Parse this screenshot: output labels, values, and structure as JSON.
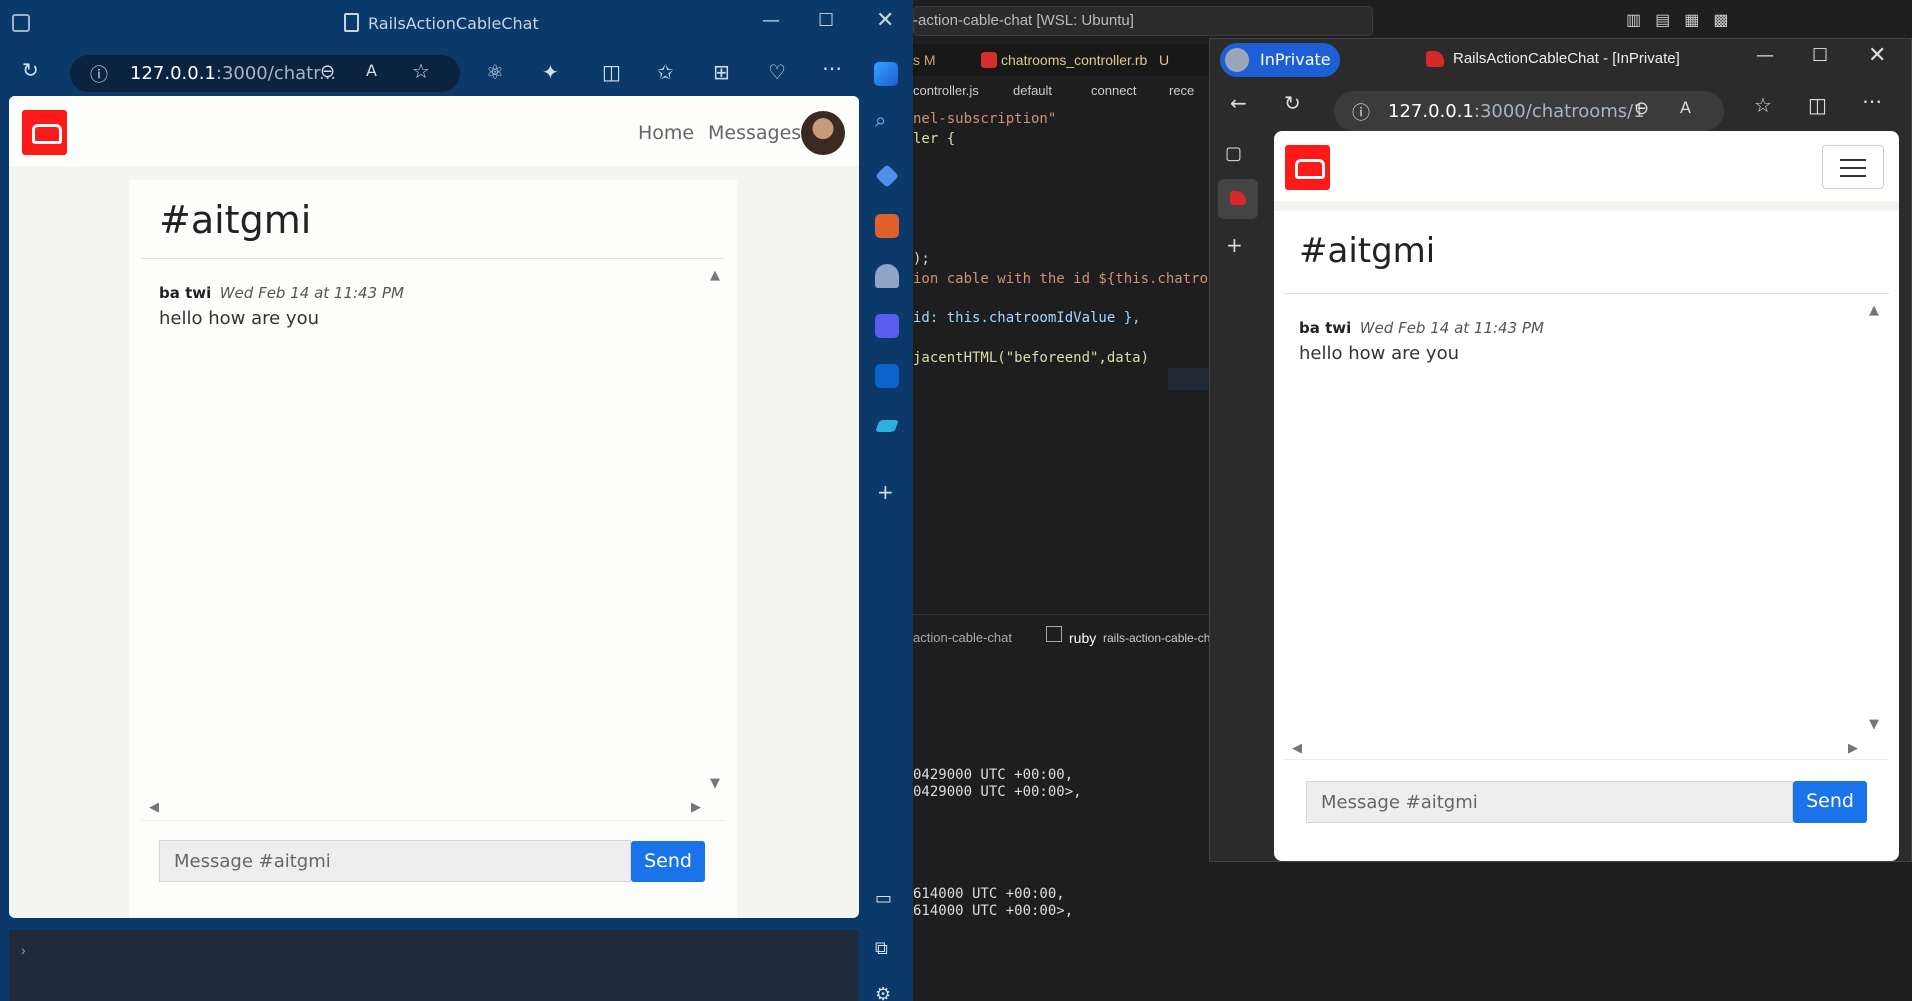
{
  "left_window": {
    "title": "RailsActionCableChat",
    "address_host": "127.0.0.1",
    "address_rest": ":3000/chatr...",
    "nav": {
      "home": "Home",
      "messages": "Messages"
    },
    "room": "#aitgmi",
    "message": {
      "author": "ba twi",
      "time": "Wed Feb 14 at 11:43 PM",
      "body": "hello how are you"
    },
    "input_placeholder": "Message #aitgmi",
    "send_label": "Send"
  },
  "vscode": {
    "title": "-action-cable-chat [WSL: Ubuntu]",
    "tabs": [
      "s M",
      "chatrooms_controller.rb",
      "U"
    ],
    "breadcrumb": [
      "controller.js",
      "default",
      "connect",
      "rece"
    ],
    "code_lines": [
      "nel-subscription\"",
      "ler {",
      "",
      "",
      "",
      "",
      ");",
      "ion cable with the id ${this.chatroom",
      "",
      "id: this.chatroomIdValue },",
      "",
      "jacentHTML(\"beforeend\",data)"
    ],
    "terminal_tabs": [
      "action-cable-chat",
      "ruby",
      "rails-action-cable-ch"
    ],
    "terminal_lines": [
      "0429000 UTC +00:00,",
      "0429000 UTC +00:00>,",
      "",
      "",
      "",
      "",
      "",
      "614000 UTC +00:00,",
      "614000 UTC +00:00>,"
    ]
  },
  "right_window": {
    "private_label": "InPrivate",
    "title": "RailsActionCableChat - [InPrivate]",
    "address_host": "127.0.0.1",
    "address_rest": ":3000/chatrooms/1",
    "room": "#aitgmi",
    "message": {
      "author": "ba twi",
      "time": "Wed Feb 14 at 11:43 PM",
      "body": "hello how are you"
    },
    "input_placeholder": "Message #aitgmi",
    "send_label": "Send"
  }
}
